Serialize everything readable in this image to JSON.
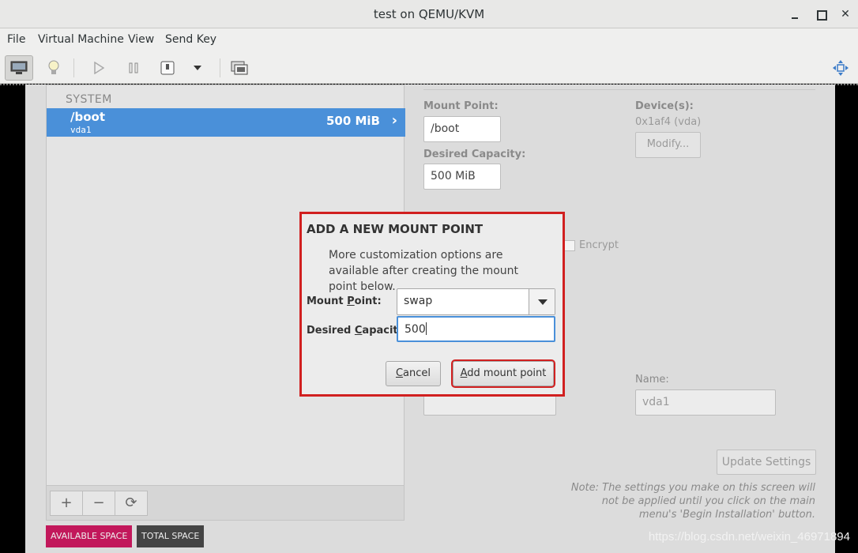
{
  "window": {
    "title": "test on QEMU/KVM"
  },
  "menu": {
    "items": [
      "File",
      "Virtual Machine",
      "View",
      "Send Key"
    ]
  },
  "left_panel": {
    "section": "SYSTEM",
    "row": {
      "name": "/boot",
      "device": "vda1",
      "size": "500 MiB"
    },
    "buttons": {
      "add": "+",
      "remove": "−",
      "refresh": "⟳"
    },
    "available_space": "AVAILABLE SPACE",
    "total_space": "TOTAL SPACE"
  },
  "details": {
    "mount_point_label": "Mount Point:",
    "mount_point_value": "/boot",
    "desired_capacity_label": "Desired Capacity:",
    "desired_capacity_value": "500 MiB",
    "devices_label": "Device(s):",
    "devices_value": "0x1af4 (vda)",
    "modify_button": "Modify...",
    "encrypt_label": "Encrypt",
    "name_label": "Name:",
    "name_value": "vda1",
    "update_button": "Update Settings",
    "note": "Note:  The settings you make on this screen will not be applied until you click on the main menu's 'Begin Installation' button."
  },
  "dialog": {
    "title": "ADD A NEW MOUNT POINT",
    "message": "More customization options are available after creating the mount point below.",
    "mount_point_label_pre": "Mount ",
    "mount_point_label_ul": "P",
    "mount_point_label_post": "oint:",
    "mount_point_value": "swap",
    "capacity_label_pre": "Desired ",
    "capacity_label_ul": "C",
    "capacity_label_post": "apacity:",
    "capacity_value": "500",
    "cancel_ul": "C",
    "cancel_rest": "ancel",
    "add_ul": "A",
    "add_rest": "dd mount point"
  },
  "watermark": "https://blog.csdn.net/weixin_46971894",
  "colors": {
    "selection": "#4a90d9",
    "highlight_box": "#d12020",
    "available_space": "#c2185b",
    "total_space": "#444444"
  }
}
